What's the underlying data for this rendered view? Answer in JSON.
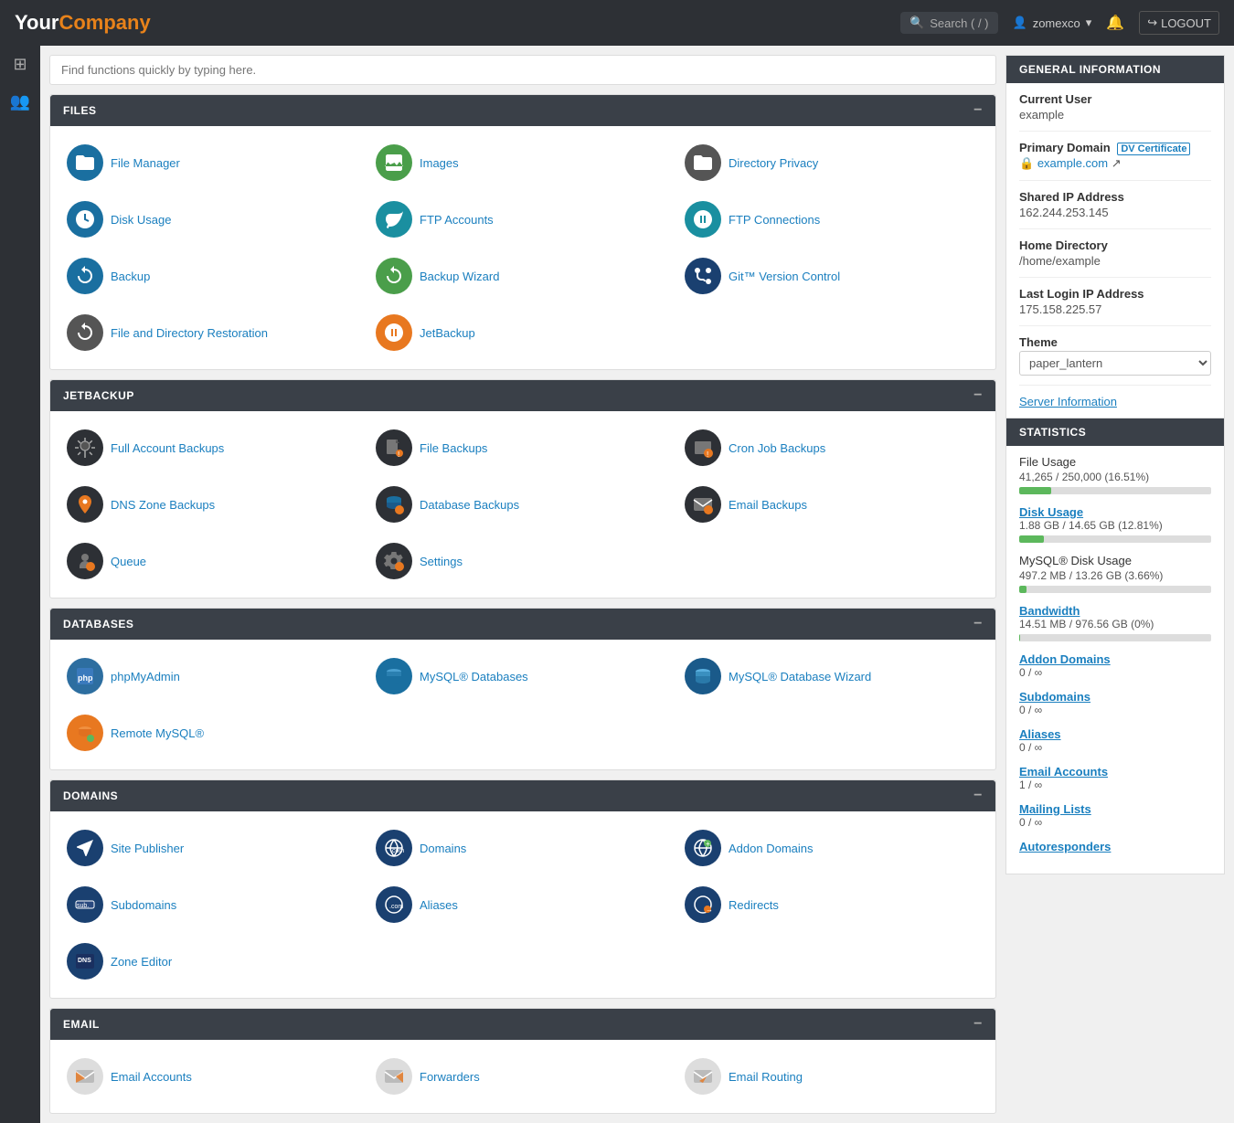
{
  "brand": {
    "your": "Your",
    "company": "Company"
  },
  "topnav": {
    "search_label": "Search ( / )",
    "user": "zomexco",
    "logout_label": "LOGOUT"
  },
  "quicksearch": {
    "placeholder": "Find functions quickly by typing here."
  },
  "sections": {
    "files": {
      "title": "FILES",
      "items": [
        {
          "label": "File Manager",
          "icon": "folder"
        },
        {
          "label": "Images",
          "icon": "image"
        },
        {
          "label": "Directory Privacy",
          "icon": "folder-lock"
        },
        {
          "label": "Disk Usage",
          "icon": "disk"
        },
        {
          "label": "FTP Accounts",
          "icon": "ftp"
        },
        {
          "label": "FTP Connections",
          "icon": "ftp-conn"
        },
        {
          "label": "Backup",
          "icon": "backup"
        },
        {
          "label": "Backup Wizard",
          "icon": "backup-wiz"
        },
        {
          "label": "Git™ Version Control",
          "icon": "git"
        },
        {
          "label": "File and Directory Restoration",
          "icon": "restore"
        },
        {
          "label": "JetBackup",
          "icon": "jetbackup"
        }
      ]
    },
    "jetbackup": {
      "title": "JETBACKUP",
      "items": [
        {
          "label": "Full Account Backups",
          "icon": "full-backup"
        },
        {
          "label": "File Backups",
          "icon": "file-backup"
        },
        {
          "label": "Cron Job Backups",
          "icon": "cron-backup"
        },
        {
          "label": "DNS Zone Backups",
          "icon": "dns-backup"
        },
        {
          "label": "Database Backups",
          "icon": "db-backup"
        },
        {
          "label": "Email Backups",
          "icon": "email-backup"
        },
        {
          "label": "Queue",
          "icon": "queue"
        },
        {
          "label": "Settings",
          "icon": "settings"
        }
      ]
    },
    "databases": {
      "title": "DATABASES",
      "items": [
        {
          "label": "phpMyAdmin",
          "icon": "phpmyadmin"
        },
        {
          "label": "MySQL® Databases",
          "icon": "mysql"
        },
        {
          "label": "MySQL® Database Wizard",
          "icon": "mysql-wiz"
        },
        {
          "label": "Remote MySQL®",
          "icon": "remote-mysql"
        }
      ]
    },
    "domains": {
      "title": "DOMAINS",
      "items": [
        {
          "label": "Site Publisher",
          "icon": "site-pub"
        },
        {
          "label": "Domains",
          "icon": "domains"
        },
        {
          "label": "Addon Domains",
          "icon": "addon-domains"
        },
        {
          "label": "Subdomains",
          "icon": "subdomains"
        },
        {
          "label": "Aliases",
          "icon": "aliases"
        },
        {
          "label": "Redirects",
          "icon": "redirects"
        },
        {
          "label": "Zone Editor",
          "icon": "zone-editor"
        }
      ]
    },
    "email": {
      "title": "EMAIL",
      "items": [
        {
          "label": "Email Accounts",
          "icon": "email-accounts"
        },
        {
          "label": "Forwarders",
          "icon": "forwarders"
        },
        {
          "label": "Email Routing",
          "icon": "email-routing"
        }
      ]
    }
  },
  "general_info": {
    "title": "GENERAL INFORMATION",
    "current_user_label": "Current User",
    "current_user": "example",
    "primary_domain_label": "Primary Domain",
    "dv_cert": "DV Certificate",
    "domain_link": "example.com",
    "shared_ip_label": "Shared IP Address",
    "shared_ip": "162.244.253.145",
    "home_dir_label": "Home Directory",
    "home_dir": "/home/example",
    "last_login_label": "Last Login IP Address",
    "last_login": "175.158.225.57",
    "theme_label": "Theme",
    "theme_value": "paper_lantern",
    "server_info_label": "Server Information"
  },
  "statistics": {
    "title": "STATISTICS",
    "file_usage_label": "File Usage",
    "file_usage_value": "41,265 / 250,000  (16.51%)",
    "file_usage_pct": 16.51,
    "disk_usage_label": "Disk Usage",
    "disk_usage_value": "1.88 GB / 14.65 GB  (12.81%)",
    "disk_usage_pct": 12.81,
    "mysql_disk_label": "MySQL® Disk Usage",
    "mysql_disk_value": "497.2 MB / 13.26 GB  (3.66%)",
    "mysql_disk_pct": 3.66,
    "bandwidth_label": "Bandwidth",
    "bandwidth_value": "14.51 MB / 976.56 GB  (0%)",
    "bandwidth_pct": 0.1,
    "addon_domains_label": "Addon Domains",
    "addon_domains_value": "0 / ∞",
    "subdomains_label": "Subdomains",
    "subdomains_value": "0 / ∞",
    "aliases_label": "Aliases",
    "aliases_value": "0 / ∞",
    "email_accounts_label": "Email Accounts",
    "email_accounts_value": "1 / ∞",
    "mailing_lists_label": "Mailing Lists",
    "mailing_lists_value": "0 / ∞",
    "autoresponders_label": "Autoresponders"
  }
}
